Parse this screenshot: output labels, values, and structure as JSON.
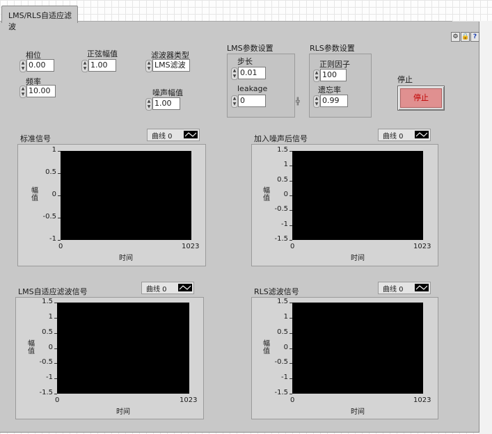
{
  "tab": {
    "label": "LMS/RLS自适应滤波"
  },
  "controls": {
    "phase": {
      "label": "相位",
      "value": "0.00"
    },
    "freq": {
      "label": "频率",
      "value": "10.00"
    },
    "sine_amp": {
      "label": "正弦幅值",
      "value": "1.00"
    },
    "filter_type": {
      "label": "滤波器类型",
      "value": "LMS滤波"
    },
    "noise_amp": {
      "label": "噪声幅值",
      "value": "1.00"
    }
  },
  "lms": {
    "title": "LMS参数设置",
    "step_label": "步长",
    "step_value": "0.01",
    "leakage_label": "leakage",
    "leakage_value": "0"
  },
  "rls": {
    "title": "RLS参数设置",
    "reg_label": "正则因子",
    "reg_value": "100",
    "forget_label": "遗忘率",
    "forget_value": "0.99"
  },
  "stop": {
    "label": "停止",
    "button": "停止"
  },
  "icons": {
    "toolbar": [
      "settings-icon",
      "lock-icon",
      "help-icon"
    ]
  },
  "graphs": {
    "standard": {
      "title": "标准信号",
      "legend": "曲线 0",
      "ylabel": "幅值",
      "xlabel": "时间",
      "yticks": [
        "1",
        "0.5",
        "0",
        "-0.5",
        "-1"
      ],
      "xticks": [
        "0",
        "1023"
      ]
    },
    "noisy": {
      "title": "加入噪声后信号",
      "legend": "曲线 0",
      "ylabel": "幅值",
      "xlabel": "时间",
      "yticks": [
        "1.5",
        "1",
        "0.5",
        "0",
        "-0.5",
        "-1",
        "-1.5"
      ],
      "xticks": [
        "0",
        "1023"
      ]
    },
    "lms": {
      "title": "LMS自适应滤波信号",
      "legend": "曲线 0",
      "ylabel": "幅值",
      "xlabel": "时间",
      "yticks": [
        "1.5",
        "1",
        "0.5",
        "0",
        "-0.5",
        "-1",
        "-1.5"
      ],
      "xticks": [
        "0",
        "1023"
      ]
    },
    "rls": {
      "title": "RLS滤波信号",
      "legend": "曲线 0",
      "ylabel": "幅值",
      "xlabel": "时间",
      "yticks": [
        "1.5",
        "1",
        "0.5",
        "0",
        "-0.5",
        "-1",
        "-1.5"
      ],
      "xticks": [
        "0",
        "1023"
      ]
    }
  },
  "colors": {
    "panel": "#c8c8c8",
    "plot_bg": "#000000",
    "stop_face": "#e09090",
    "stop_text": "#c00000"
  }
}
